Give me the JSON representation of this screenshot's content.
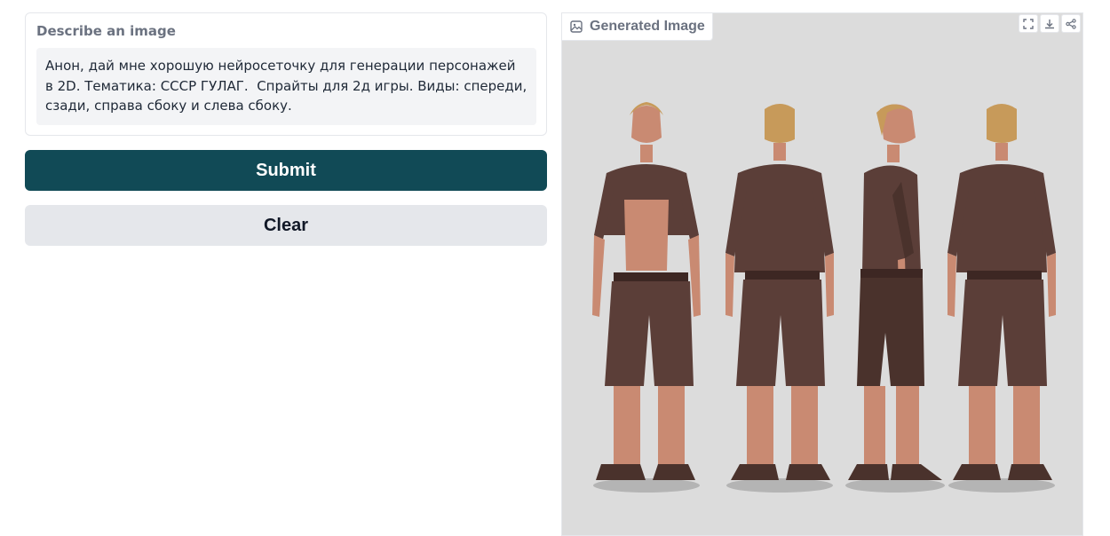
{
  "prompt": {
    "label": "Describe an image",
    "value": "Анон, дай мне хорошую нейросеточку для генерации персонажей в 2D. Тематика: СССР ГУЛАГ.  Спрайты для 2д игры. Виды: спереди, сзади, справа сбоку и слева сбоку."
  },
  "buttons": {
    "submit_label": "Submit",
    "clear_label": "Clear"
  },
  "output": {
    "label": "Generated Image",
    "tools": [
      "fullscreen-icon",
      "download-icon",
      "share-icon"
    ]
  },
  "colors": {
    "primary": "#114a56",
    "secondary": "#e5e7eb",
    "image_bg": "#dcdcdc",
    "garment": "#5b3e38",
    "skin": "#c98a72",
    "hair": "#c79a5a"
  }
}
